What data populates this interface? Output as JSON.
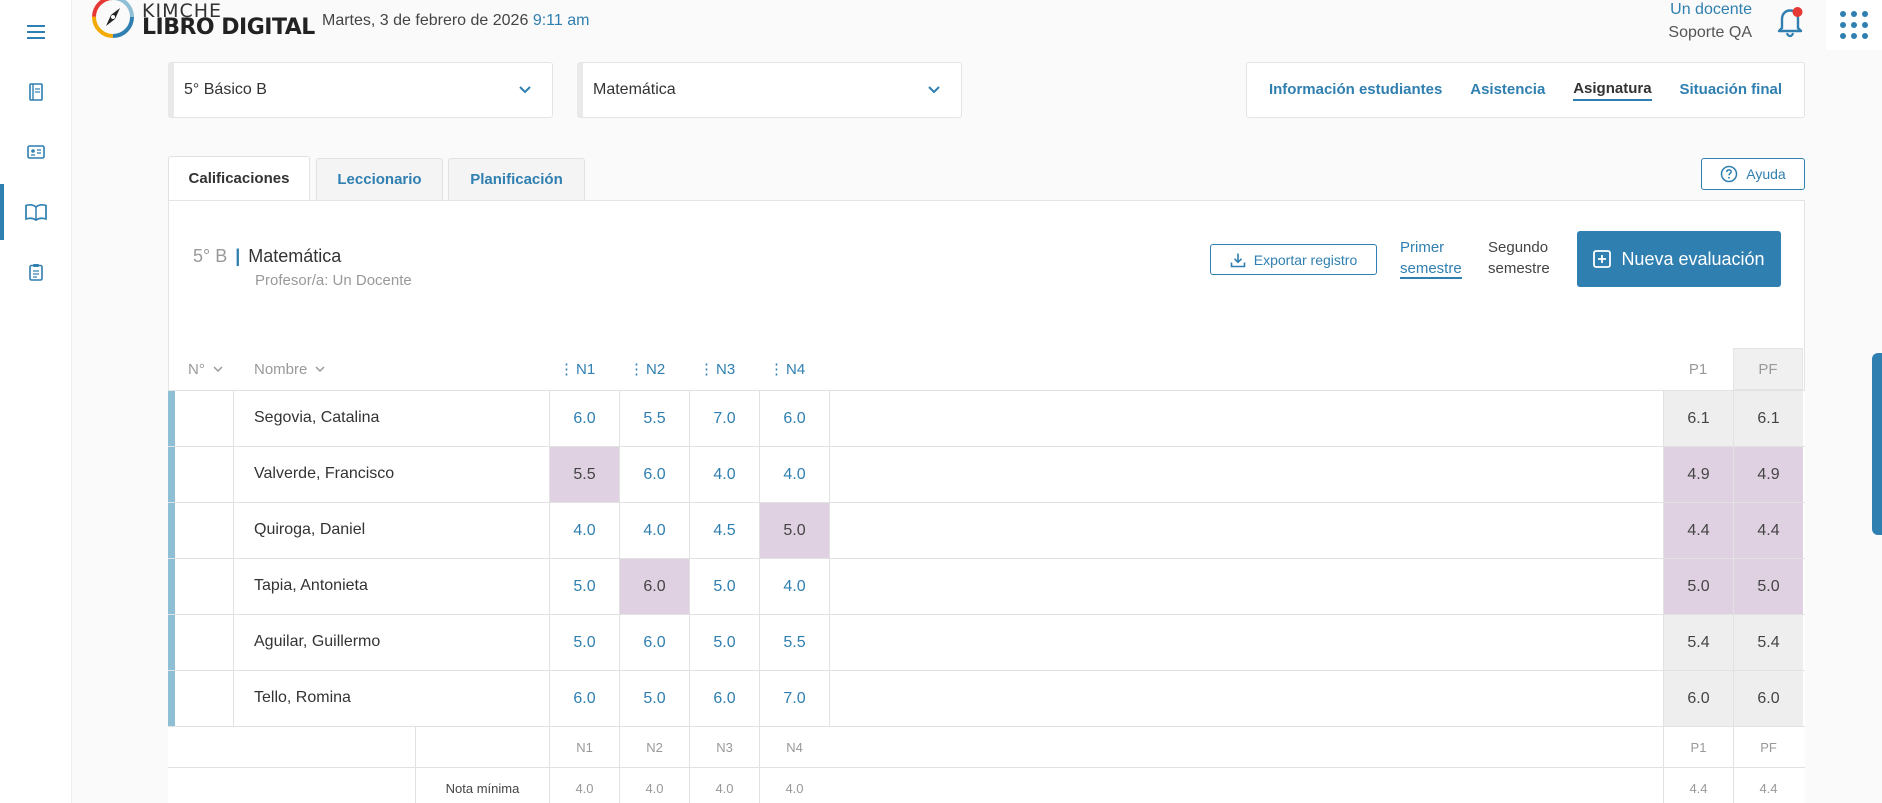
{
  "header": {
    "brand_top": "KIMCHE",
    "brand_bottom": "LIBRO DIGITAL",
    "date": "Martes, 3 de febrero de 2026",
    "time": "9:11 am",
    "user_name": "Un docente",
    "user_role": "Soporte QA",
    "notification_dot_color": "#e53935"
  },
  "sidebar": {
    "items": [
      {
        "icon": "menu-icon"
      },
      {
        "icon": "notebook-icon"
      },
      {
        "icon": "id-card-icon"
      },
      {
        "icon": "open-book-icon",
        "active": true
      },
      {
        "icon": "clipboard-icon"
      }
    ]
  },
  "selectors": {
    "course": "5° Básico B",
    "subject": "Matemática"
  },
  "nav_tabs": [
    "Información estudiantes",
    "Asistencia",
    "Asignatura",
    "Situación final"
  ],
  "nav_active": "Asignatura",
  "sub_tabs": [
    "Calificaciones",
    "Leccionario",
    "Planificación"
  ],
  "sub_active": "Calificaciones",
  "help_label": "Ayuda",
  "panel": {
    "course_short": "5° B",
    "separator": "|",
    "subject": "Matemática",
    "teacher": "Profesor/a: Un Docente",
    "export_label": "Exportar registro",
    "semester1_line1": "Primer",
    "semester1_line2": "semestre",
    "semester2_line1": "Segundo",
    "semester2_line2": "semestre",
    "new_eval_label": "Nueva evaluación"
  },
  "table": {
    "col_num": "N°",
    "col_name": "Nombre",
    "grade_cols": [
      "N1",
      "N2",
      "N3",
      "N4"
    ],
    "avg_cols": [
      "P1",
      "PF"
    ],
    "rows": [
      {
        "name": "Segovia, Catalina",
        "grades": [
          "6.0",
          "5.5",
          "7.0",
          "6.0"
        ],
        "p1": "6.1",
        "pf": "6.1",
        "low": [
          false,
          false,
          false,
          false
        ],
        "avg_low": false
      },
      {
        "name": "Valverde, Francisco",
        "grades": [
          "5.5",
          "6.0",
          "4.0",
          "4.0"
        ],
        "p1": "4.9",
        "pf": "4.9",
        "low": [
          true,
          false,
          false,
          false
        ],
        "avg_low": true
      },
      {
        "name": "Quiroga, Daniel",
        "grades": [
          "4.0",
          "4.0",
          "4.5",
          "5.0"
        ],
        "p1": "4.4",
        "pf": "4.4",
        "low": [
          false,
          false,
          false,
          true
        ],
        "avg_low": true
      },
      {
        "name": "Tapia, Antonieta",
        "grades": [
          "5.0",
          "6.0",
          "5.0",
          "4.0"
        ],
        "p1": "5.0",
        "pf": "5.0",
        "low": [
          false,
          true,
          false,
          false
        ],
        "avg_low": true
      },
      {
        "name": "Aguilar, Guillermo",
        "grades": [
          "5.0",
          "6.0",
          "5.0",
          "5.5"
        ],
        "p1": "5.4",
        "pf": "5.4",
        "low": [
          false,
          false,
          false,
          false
        ],
        "avg_low": false
      },
      {
        "name": "Tello, Romina",
        "grades": [
          "6.0",
          "5.0",
          "6.0",
          "7.0"
        ],
        "p1": "6.0",
        "pf": "6.0",
        "low": [
          false,
          false,
          false,
          false
        ],
        "avg_low": false
      }
    ],
    "summary_header": [
      "N1",
      "N2",
      "N3",
      "N4",
      "P1",
      "PF"
    ],
    "summary_label": "Nota mínima",
    "summary_values": [
      "4.0",
      "4.0",
      "4.0",
      "4.0",
      "4.4",
      "4.4"
    ]
  },
  "colors": {
    "accent": "#2f7fb0",
    "highlight": "#dfd1e2",
    "row_marker": "#8fbfd4"
  }
}
